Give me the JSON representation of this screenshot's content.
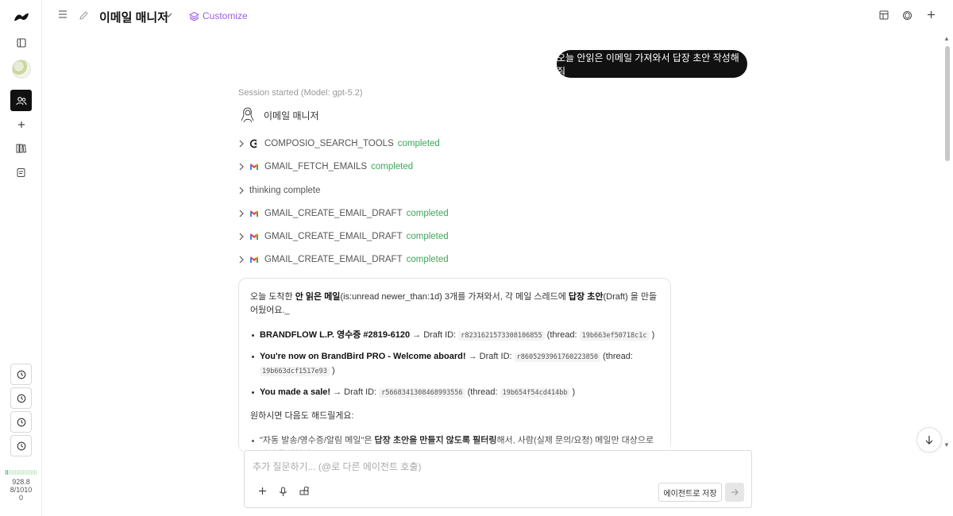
{
  "header": {
    "title": "이메일 매니저",
    "customize_label": "Customize"
  },
  "conversation": {
    "user_message": "오늘 안읽은 이메일 가져와서 답장 초안 작성해줘",
    "session_text": "Session started (Model: gpt-5.2)",
    "agent_name": "이메일 매니저",
    "steps": [
      {
        "icon": "composio-icon",
        "name": "COMPOSIO_SEARCH_TOOLS",
        "status": "completed"
      },
      {
        "icon": "gmail-icon",
        "name": "GMAIL_FETCH_EMAILS",
        "status": "completed"
      },
      {
        "icon": "",
        "name": "thinking complete",
        "status": ""
      },
      {
        "icon": "gmail-icon",
        "name": "GMAIL_CREATE_EMAIL_DRAFT",
        "status": "completed"
      },
      {
        "icon": "gmail-icon",
        "name": "GMAIL_CREATE_EMAIL_DRAFT",
        "status": "completed"
      },
      {
        "icon": "gmail-icon",
        "name": "GMAIL_CREATE_EMAIL_DRAFT",
        "status": "completed"
      }
    ],
    "answer": {
      "intro_1": "오늘 도착한 ",
      "intro_bold_1": "안 읽은 메일",
      "intro_2": "(is:unread newer_than:1d) 3개를 가져와서, 각 메일 스레드에 ",
      "intro_bold_2": "답장 초안",
      "intro_3": "(Draft) 을 만들어뒀어요._",
      "drafts": [
        {
          "subject": "BRANDFLOW L.P. 영수증 #2819-6120",
          "arrow": " → Draft ID: ",
          "draft_id": "r8231621573308106855",
          "thread_label": " (thread: ",
          "thread_id": "19b663ef50718c1c",
          "close": " )"
        },
        {
          "subject": "You're now on BrandBird PRO - Welcome aboard!",
          "arrow": " → Draft ID: ",
          "draft_id": "r8605293961760223850",
          "thread_label": " (thread: ",
          "thread_id": "19b663dcf1517e93",
          "close": " )"
        },
        {
          "subject": "You made a sale!",
          "arrow": " → Draft ID: ",
          "draft_id": "r5668341308468993556",
          "thread_label": " (thread: ",
          "thread_id": "19b654f54cd414bb",
          "close": " )"
        }
      ],
      "followup_heading": "원하시면 다음도 해드릴게요:",
      "followups": [
        {
          "text_1": "\"자동 발송/영수증/알림 메일\"은 ",
          "bold": "답장 초안을 만들지 않도록 필터링",
          "text_2": "해서, 사람(실제 문의/요청) 메일만 대상으로 다시 작성하기"
        }
      ]
    }
  },
  "composer": {
    "placeholder": "추가 질문하기... (@로 다른 에이전트 호출)",
    "save_agent_label": "에이전트로 저장"
  },
  "sidebar_stats": {
    "line1": "928.8",
    "line2": "8/1010",
    "line3": "0"
  },
  "colors": {
    "accent": "#9b5de5",
    "status_completed": "#3aa85a",
    "user_bubble": "#111111"
  }
}
